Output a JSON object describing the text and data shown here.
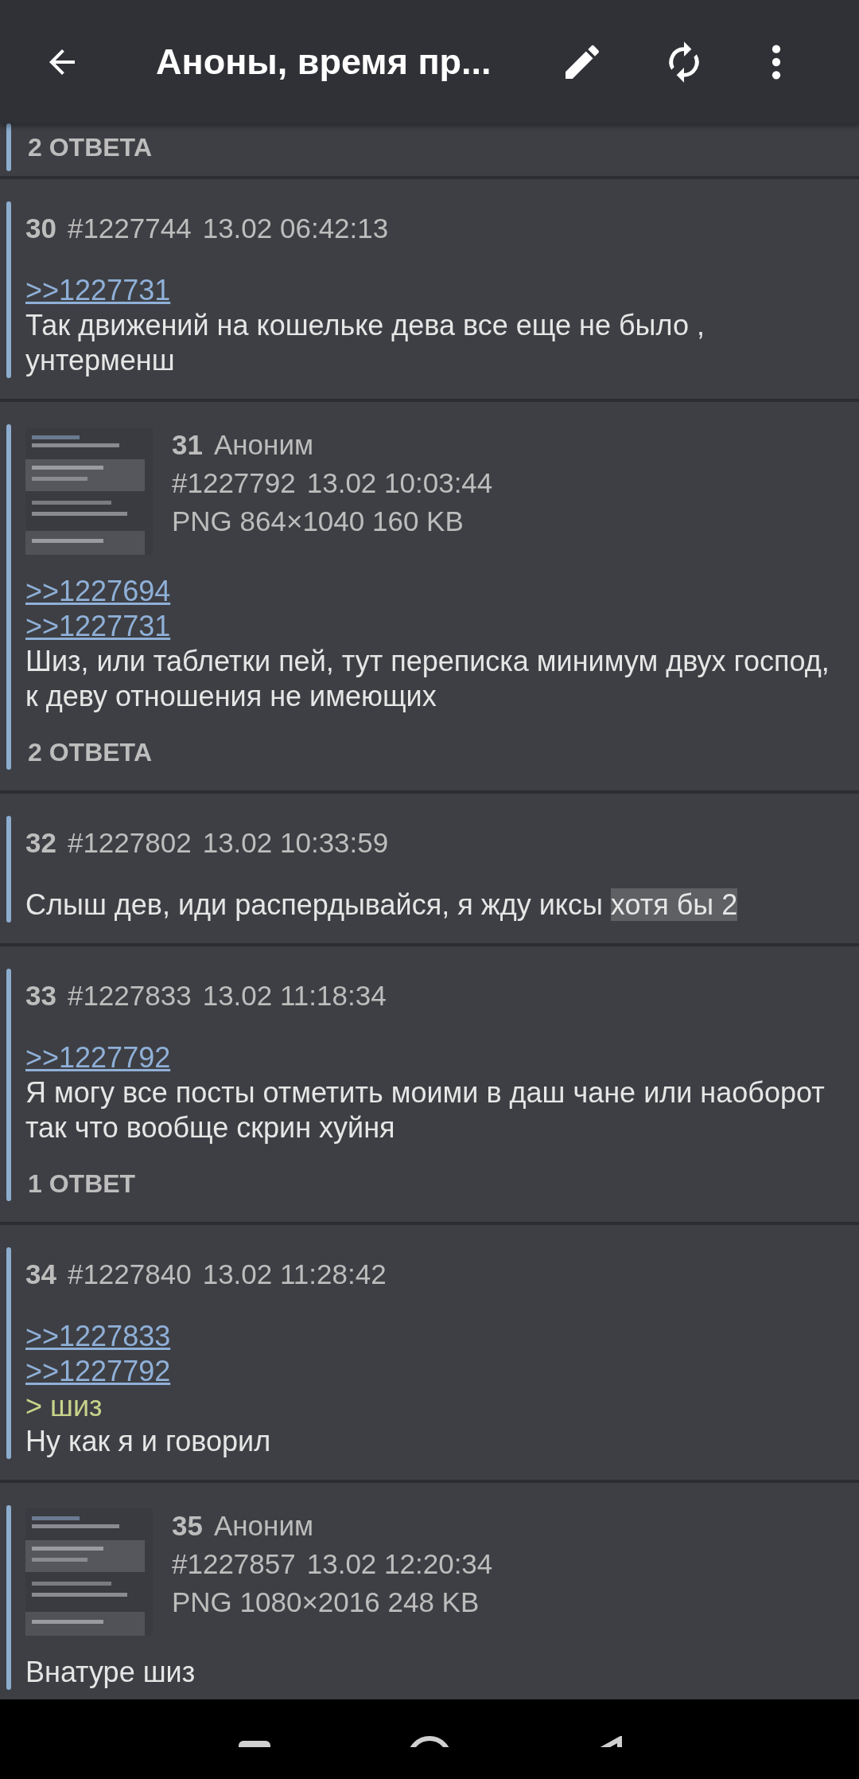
{
  "app_bar": {
    "title": "Аноны, время пр..."
  },
  "posts": [
    {
      "replies": "2 ОТВЕТА"
    },
    {
      "number": "30",
      "id": "#1227744",
      "date": "13.02 06:42:13",
      "lines": [
        {
          "kind": "link",
          "text": ">>1227731"
        },
        {
          "kind": "text",
          "text": "Так движений на кошельке дева все еще не было , унтерменш"
        }
      ]
    },
    {
      "number": "31",
      "author": "Аноним",
      "id": "#1227792",
      "date": "13.02 10:03:44",
      "file": "PNG 864×1040 160 KB",
      "thumb": {
        "kind": "picture"
      },
      "lines": [
        {
          "kind": "link",
          "text": ">>1227694"
        },
        {
          "kind": "link",
          "text": ">>1227731"
        },
        {
          "kind": "text",
          "text": "Шиз, или таблетки пей, тут переписка минимум двух господ, к деву отношения не имеющих"
        }
      ],
      "replies": "2 ОТВЕТА"
    },
    {
      "number": "32",
      "id": "#1227802",
      "date": "13.02 10:33:59",
      "lines": [
        {
          "kind": "text",
          "text": "Слыш дев, иди распердывайся, я жду иксы ",
          "spoiler": "хотя бы 2"
        }
      ]
    },
    {
      "number": "33",
      "id": "#1227833",
      "date": "13.02 11:18:34",
      "lines": [
        {
          "kind": "link",
          "text": ">>1227792"
        },
        {
          "kind": "text",
          "text": "Я могу все посты отметить моими в даш чане или наоборот так что вообще скрин хуйня"
        }
      ],
      "replies": "1 ОТВЕТ"
    },
    {
      "number": "34",
      "id": "#1227840",
      "date": "13.02 11:28:42",
      "lines": [
        {
          "kind": "link",
          "text": ">>1227833"
        },
        {
          "kind": "link",
          "text": ">>1227792"
        },
        {
          "kind": "quote",
          "text": "> шиз"
        },
        {
          "kind": "text",
          "text": "Ну как я и говорил"
        }
      ]
    },
    {
      "number": "35",
      "author": "Аноним",
      "id": "#1227857",
      "date": "13.02 12:20:34",
      "file": "PNG 1080×2016 248 KB",
      "thumb": {
        "kind": "picture"
      },
      "lines": [
        {
          "kind": "text",
          "text": "Внатуре шиз"
        }
      ]
    }
  ]
}
